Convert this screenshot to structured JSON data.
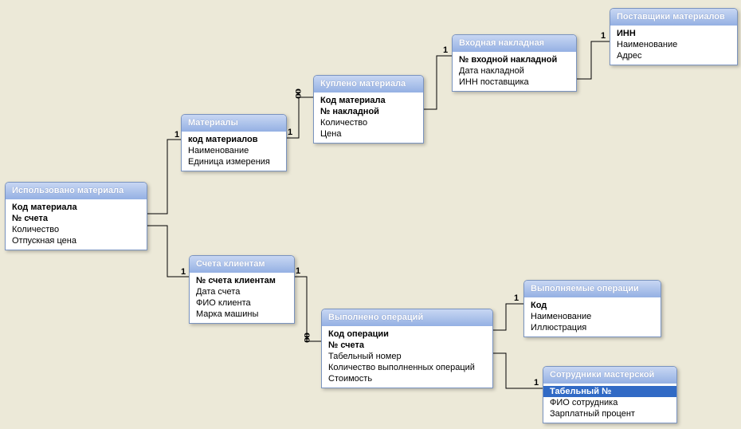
{
  "entities": {
    "used": {
      "title": "Использовано материала",
      "fields": [
        "Код материала",
        "№ счета",
        "Количество",
        "Отпускная цена"
      ],
      "pk": [
        0,
        1
      ]
    },
    "materials": {
      "title": "Материалы",
      "fields": [
        "код материалов",
        "Наименование",
        "Единица измерения"
      ],
      "pk": [
        0
      ]
    },
    "bought": {
      "title": "Куплено материала",
      "fields": [
        "Код материала",
        "№ накладной",
        "Количество",
        "Цена"
      ],
      "pk": [
        0,
        1
      ]
    },
    "invoice_in": {
      "title": "Входная накладная",
      "fields": [
        "№ входной накладной",
        "Дата накладной",
        "ИНН поставщика"
      ],
      "pk": [
        0
      ]
    },
    "suppliers": {
      "title": "Поставщики материалов",
      "fields": [
        "ИНН",
        "Наименование",
        "Адрес"
      ],
      "pk": [
        0
      ]
    },
    "bills": {
      "title": "Счета клиентам",
      "fields": [
        "№ счета клиентам",
        "Дата счета",
        "ФИО клиента",
        "Марка машины"
      ],
      "pk": [
        0
      ]
    },
    "ops_done": {
      "title": "Выполнено операций",
      "fields": [
        "Код операции",
        "№ счета",
        "Табельный номер",
        "Количество выполненных операций",
        "Стоимость"
      ],
      "pk": [
        0,
        1
      ]
    },
    "ops": {
      "title": "Выполняемые операции",
      "fields": [
        "Код",
        "Наименование",
        "Иллюстрация"
      ],
      "pk": [
        0
      ]
    },
    "staff": {
      "title": "Сотрудники мастерской",
      "fields": [
        "Табельный №",
        "ФИО сотрудника",
        "Зарплатный процент"
      ],
      "pk": [
        0
      ]
    }
  },
  "relations": [
    {
      "from": "materials",
      "to": "used",
      "one": "1",
      "many": "∞"
    },
    {
      "from": "bills",
      "to": "used",
      "one": "1",
      "many": "∞"
    },
    {
      "from": "materials",
      "to": "bought",
      "one": "1",
      "many": "∞"
    },
    {
      "from": "invoice_in",
      "to": "bought",
      "one": "1",
      "many": "∞"
    },
    {
      "from": "suppliers",
      "to": "invoice_in",
      "one": "1",
      "many": "∞"
    },
    {
      "from": "bills",
      "to": "ops_done",
      "one": "1",
      "many": "∞"
    },
    {
      "from": "ops",
      "to": "ops_done",
      "one": "1",
      "many": "∞"
    },
    {
      "from": "staff",
      "to": "ops_done",
      "one": "1",
      "many": "∞"
    }
  ],
  "labels": {
    "one": "1",
    "many": "oo"
  }
}
